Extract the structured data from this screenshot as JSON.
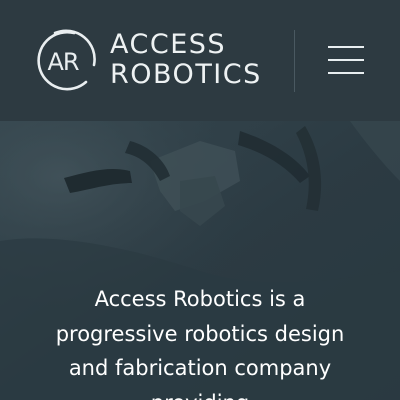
{
  "header": {
    "logo": {
      "monogram": "AR",
      "icon": "ar-monogram-logo"
    },
    "brand_line1": "ACCESS",
    "brand_line2": "ROBOTICS",
    "menu_icon": "hamburger-menu-icon"
  },
  "hero": {
    "background": "robotic-arm-photo",
    "text": "Access Robotics is a progressive robotics design and fabrication company providing"
  },
  "colors": {
    "header_bg": "#2d3a41",
    "hero_overlay": "#2f3f47",
    "text": "#ffffff"
  }
}
